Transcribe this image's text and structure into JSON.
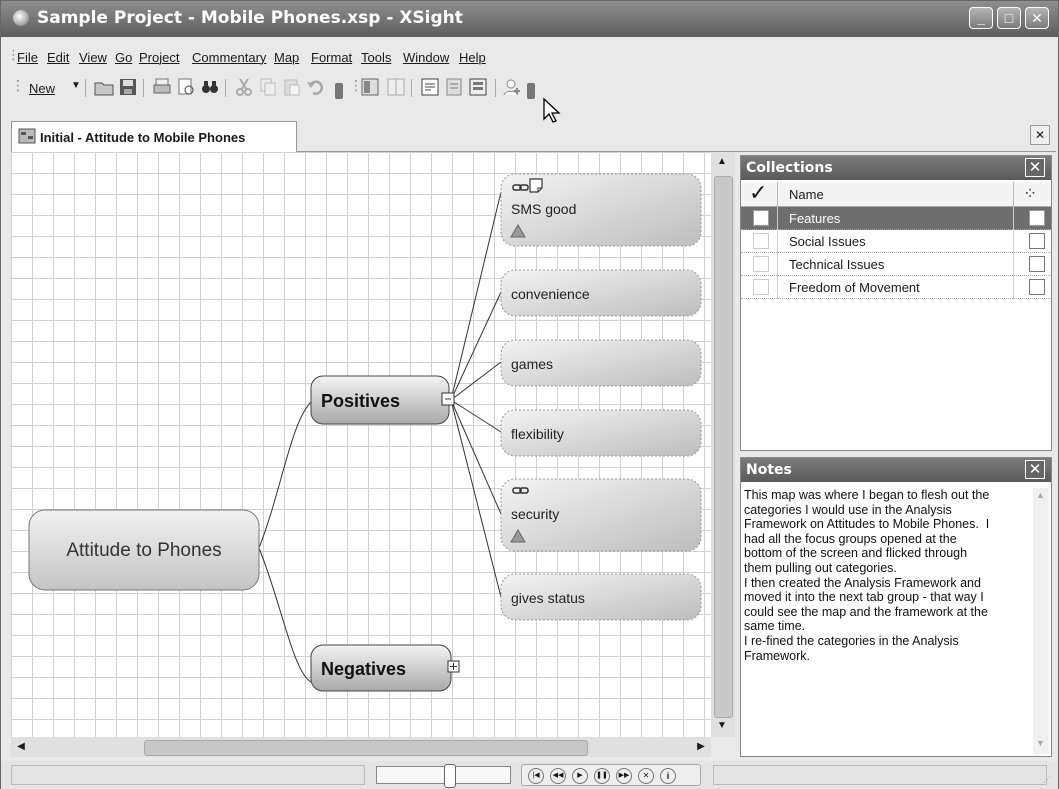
{
  "window": {
    "title": "Sample Project - Mobile Phones.xsp - XSight"
  },
  "menu": [
    "File",
    "Edit",
    "View",
    "Go",
    "Project",
    "Commentary",
    "Map",
    "Format",
    "Tools",
    "Window",
    "Help"
  ],
  "toolbar": {
    "new_label": "New"
  },
  "tab": {
    "label": "Initial - Attitude to Mobile Phones"
  },
  "map": {
    "root": "Attitude to Phones",
    "positives": "Positives",
    "negatives": "Negatives",
    "children": [
      "SMS good",
      "convenience",
      "games",
      "flexibility",
      "security",
      "gives status"
    ]
  },
  "collections": {
    "title": "Collections",
    "column_name": "Name",
    "items": [
      "Features",
      "Social Issues",
      "Technical Issues",
      "Freedom of Movement"
    ],
    "selected_index": 0
  },
  "notes": {
    "title": "Notes",
    "text": "This map was where I began to flesh out the\ncategories I would use in the Analysis\nFramework on Attitudes to Mobile Phones.  I\nhad all the focus groups opened at the\nbottom of the screen and flicked through\nthem pulling out categories.\nI then created the Analysis Framework and\nmoved it into the next tab group - that way I\ncould see the map and the framework at the\nsame time.\nI re-fined the categories in the Analysis\nFramework."
  }
}
